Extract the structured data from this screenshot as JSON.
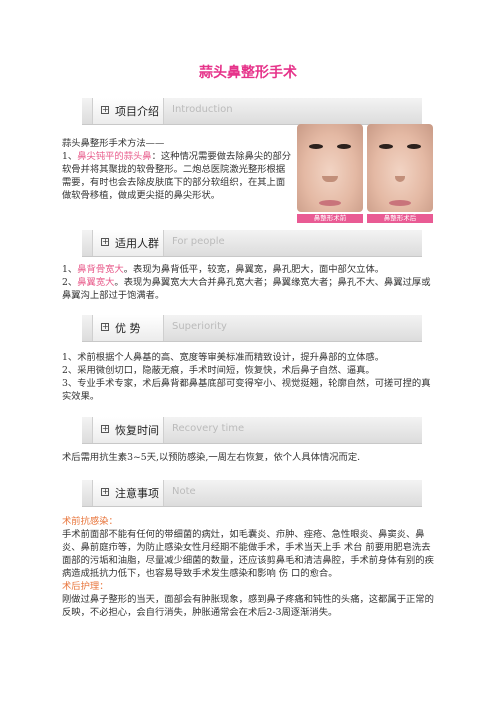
{
  "title": "蒜头鼻整形手术",
  "sections": {
    "intro": {
      "title": "项目介绍",
      "en": "Introduction"
    },
    "people": {
      "title": "适用人群",
      "en": "For people"
    },
    "superiority": {
      "title": "优  势",
      "en": "Superiority"
    },
    "recovery": {
      "title": "恢复时间",
      "en": "Recovery time"
    },
    "note": {
      "title": "注意事项",
      "en": "Note"
    }
  },
  "intro": {
    "line0": "蒜头鼻整形手术方法——",
    "item1_num": "1、",
    "item1_highlight": "鼻尖钝平的蒜头鼻",
    "item1_text": "：这种情况需要做去除鼻尖的部分软骨并将其聚拢的软骨整形。二炮总医院激光整形根据需要，有时也会去除皮肤底下的部分软组织，在其上面做软骨移植，做成更尖挺的鼻尖形状。",
    "caption_before": "鼻整形术前",
    "caption_after": "鼻整形术后"
  },
  "people": {
    "item1_num": "1、",
    "item1_highlight": "鼻背骨宽大",
    "item1_text": "。表现为鼻背低平，较宽，鼻翼宽，鼻孔肥大，面中部欠立体。",
    "item2_num": "2、",
    "item2_highlight": "鼻翼宽大",
    "item2_text": "。表现为鼻翼宽大大合并鼻孔宽大者；鼻翼缘宽大者；鼻孔不大、鼻翼过厚或鼻翼沟上部过于饱满者。"
  },
  "superiority": {
    "item1": "1、术前根据个人鼻基的高、宽度等审美标准而精致设计，提升鼻部的立体感。",
    "item2": "2、采用微创切口，隐蔽无痕，手术时间短，恢复快，术后鼻子自然、逼真。",
    "item3": "3、专业手术专家，术后鼻背都鼻基底部可变得窄小、视觉挺翘，轮廓自然，可搓可捏的真实效果。"
  },
  "recovery": {
    "text": "术后需用抗生素3~5天,以预防感染,一周左右恢复，依个人具体情况而定."
  },
  "note": {
    "pre_title": "术前抗感染：",
    "pre_text": "手术前面部不能有任何的带细菌的病灶，如毛囊炎、疖肿、痤疮、急性眼炎、鼻窦炎、鼻炎、鼻前庭疖等，为防止感染女性月经期不能做手术，手术当天上手   术台 前要用肥皂洗去面部的污垢和油脂，尽量减少细菌的数量，还应该剪鼻毛和清洁鼻腔，手术前身体有别的疾病造成抵抗力低下，也容易导致手术发生感染和影响    伤 口的愈合。",
    "post_title": "术后护理：",
    "post_text": "刚做过鼻子整形的当天，面部会有肿胀现象，感到鼻子疼痛和钝性的头痛，这都属于正常的反映，不必担心，会自行消失，肿胀通常会在术后2-3周逐渐消失。"
  }
}
